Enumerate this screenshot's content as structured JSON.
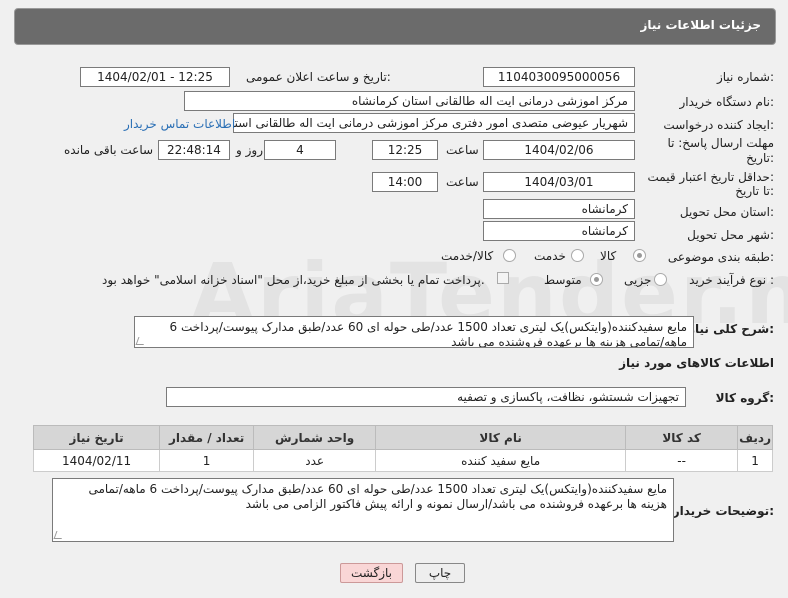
{
  "header": {
    "title": "جزئیات اطلاعات نیاز"
  },
  "form": {
    "need_number_label": "شماره نیاز:",
    "need_number": "1104030095000056",
    "announce_label": "تاریخ و ساعت اعلان عمومی:",
    "announce_value": "1404/02/01 - 12:25",
    "buyer_label": "نام دستگاه خریدار:",
    "buyer_value": "مرکز اموزشی درمانی ایت اله طالقانی استان کرمانشاه",
    "creator_label": "ایجاد کننده درخواست:",
    "creator_value": "شهریار عیوضی متصدی امور دفتری مرکز اموزشی درمانی ایت اله طالقانی استان",
    "contact_link": "اطلاعات تماس خریدار",
    "deadline_label_1": "مهلت ارسال پاسخ: تا",
    "deadline_label_2": "تاریخ:",
    "deadline_date": "1404/02/06",
    "time_label": "ساعت",
    "deadline_time": "12:25",
    "days_value": "4",
    "days_label": "روز و",
    "remaining_time": "22:48:14",
    "remaining_label": "ساعت باقی مانده",
    "min_price_label_1": "حداقل تاریخ اعتبار قیمت:",
    "min_price_label_2": "تا تاریخ:",
    "price_date": "1404/03/01",
    "price_time": "14:00",
    "province_label": "استان محل تحویل:",
    "province_value": "کرمانشاه",
    "city_label": "شهر محل تحویل:",
    "city_value": "کرمانشاه",
    "category_label": "طبقه بندی موضوعی:",
    "category_options": [
      "کالا",
      "خدمت",
      "کالا/خدمت"
    ],
    "process_label": "نوع فرآیند خرید :",
    "process_options": [
      "جزیی",
      "متوسط"
    ],
    "payment_note": "پرداخت تمام یا بخشی از مبلغ خرید،از محل \"اسناد خزانه اسلامی\" خواهد بود."
  },
  "description": {
    "label": "شرح کلی نیاز:",
    "text": "مایع سفیدکننده(وایتکس)یک لیتری تعداد 1500 عدد/طی حوله ای 60 عدد/طبق مدارک پیوست/پرداخت 6 ماهه/تمامی هزینه ها برعهده فروشنده می باشد"
  },
  "goods": {
    "section_title": "اطلاعات کالاهای مورد نیاز",
    "group_label": "گروه کالا:",
    "group_value": "تجهیزات شستشو، نظافت، پاکسازی و تصفیه",
    "columns": [
      "ردیف",
      "کد کالا",
      "نام کالا",
      "واحد شمارش",
      "تعداد / مقدار",
      "تاریخ نیاز"
    ],
    "rows": [
      {
        "index": "1",
        "code": "--",
        "name": "مایع سفید کننده",
        "unit": "عدد",
        "qty": "1",
        "date": "1404/02/11"
      }
    ]
  },
  "buyer_notes": {
    "label": "توضیحات خریدار:",
    "text": "مایع سفیدکننده(وایتکس)یک لیتری تعداد 1500 عدد/طی حوله ای 60 عدد/طبق مدارک پیوست/پرداخت 6 ماهه/تمامی هزینه ها برعهده فروشنده می باشد/ارسال نمونه و ارائه پیش فاکتور الزامی می باشد"
  },
  "buttons": {
    "print": "چاپ",
    "back": "بازگشت"
  },
  "watermark": "AriaTender.neT"
}
